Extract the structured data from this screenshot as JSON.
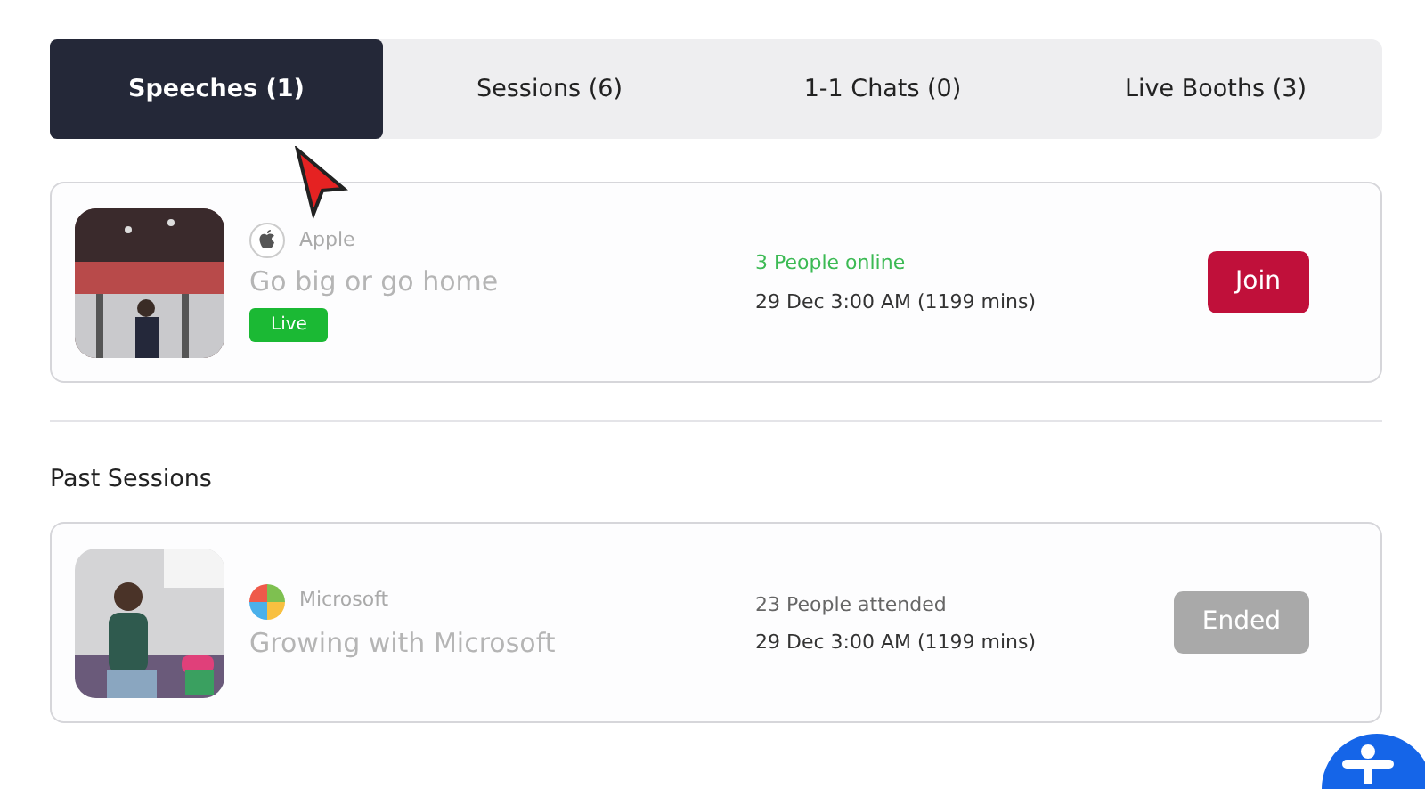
{
  "tabs": [
    {
      "label": "Speeches (1)",
      "selected": true
    },
    {
      "label": "Sessions (6)",
      "selected": false
    },
    {
      "label": "1-1 Chats (0)",
      "selected": false
    },
    {
      "label": "Live Booths (3)",
      "selected": false
    }
  ],
  "live_sessions": [
    {
      "org": "Apple",
      "title": "Go big or go home",
      "badge": "Live",
      "audience": "3 People online",
      "live": true,
      "time": "29 Dec 3:00 AM (1199 mins)",
      "action": {
        "label": "Join",
        "disabled": false
      }
    }
  ],
  "past_heading": "Past Sessions",
  "past_sessions": [
    {
      "org": "Microsoft",
      "title": "Growing with Microsoft",
      "audience": "23 People attended",
      "live": false,
      "time": "29 Dec 3:00 AM (1199 mins)",
      "action": {
        "label": "Ended",
        "disabled": true
      }
    }
  ]
}
